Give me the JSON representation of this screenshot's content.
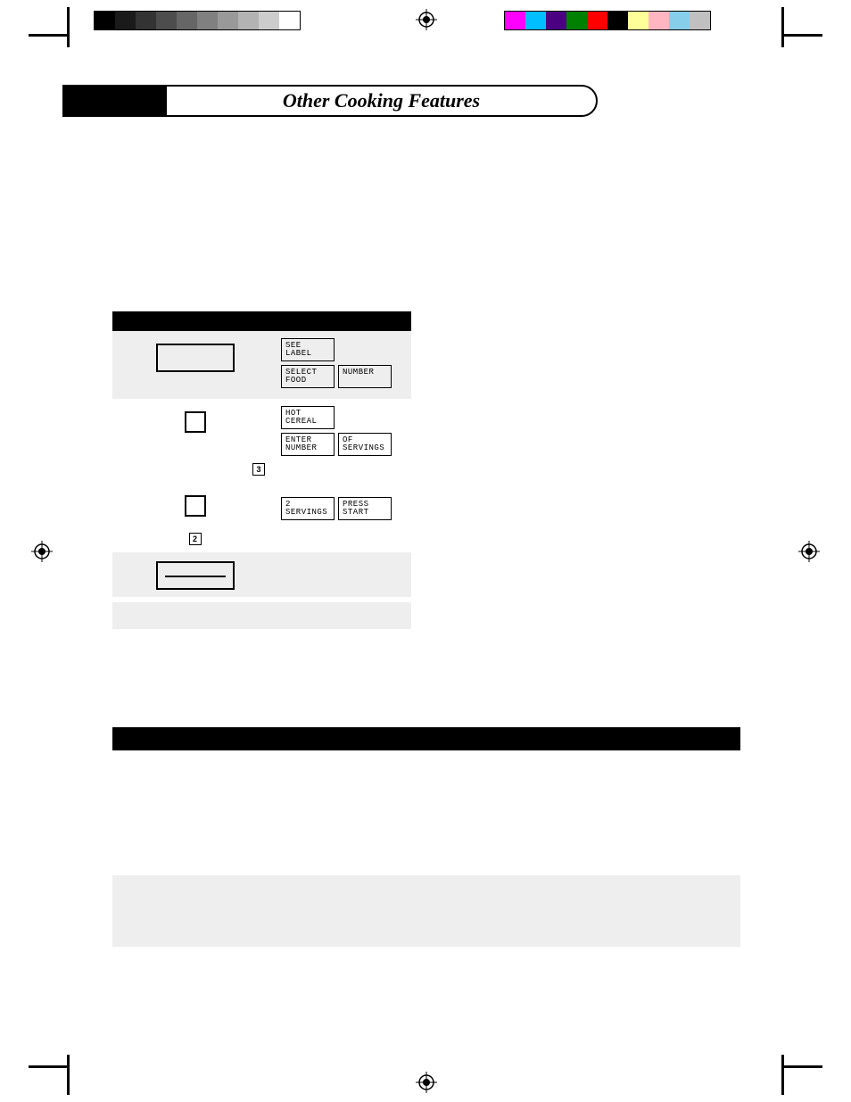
{
  "title": "Other Cooking Features",
  "colorbar_left": [
    "#000000",
    "#1a1a1a",
    "#333333",
    "#4d4d4d",
    "#666666",
    "#808080",
    "#999999",
    "#b3b3b3",
    "#cccccc",
    "#ffffff"
  ],
  "colorbar_right": [
    "#ff00ff",
    "#00bfff",
    "#4b0082",
    "#008000",
    "#ff0000",
    "#000000",
    "#ffff99",
    "#ffb6c1",
    "#87ceeb",
    "#c0c0c0"
  ],
  "steps": {
    "s1": {
      "d1": {
        "l1": "SEE",
        "l2": "LABEL"
      },
      "d2": {
        "l1": "SELECT",
        "l2": "FOOD"
      },
      "d3": {
        "l1": "NUMBER",
        "l2": ""
      }
    },
    "s2": {
      "d1": {
        "l1": "HOT",
        "l2": "CEREAL"
      },
      "d2": {
        "l1": "ENTER",
        "l2": "NUMBER"
      },
      "d3": {
        "l1": "OF",
        "l2": "SERVINGS"
      },
      "num": "3"
    },
    "s3": {
      "d1": {
        "l1": "2",
        "l2": "SERVINGS"
      },
      "d2": {
        "l1": "PRESS",
        "l2": "START"
      },
      "num": "2"
    }
  }
}
